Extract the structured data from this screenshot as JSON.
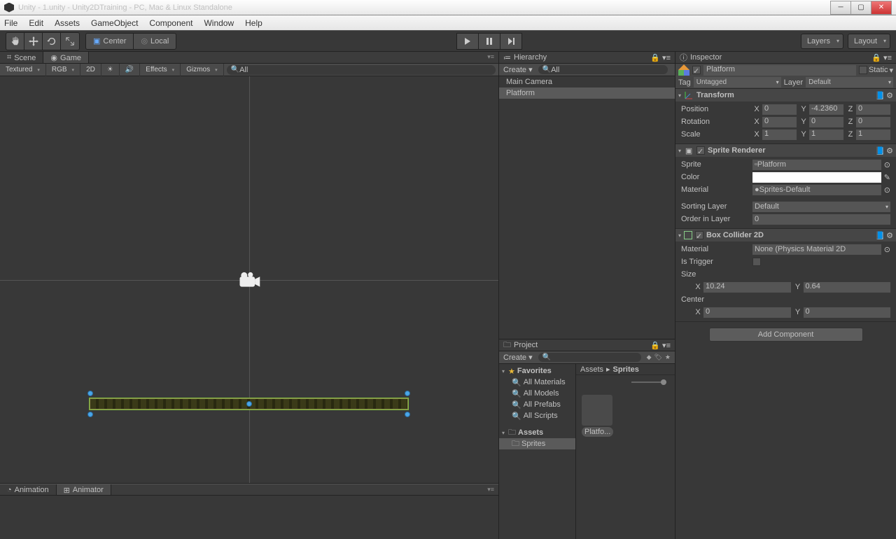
{
  "window": {
    "title": "Unity - 1.unity - Unity2DTraining - PC, Mac & Linux Standalone"
  },
  "menu": [
    "File",
    "Edit",
    "Assets",
    "GameObject",
    "Component",
    "Window",
    "Help"
  ],
  "toolbar": {
    "pivot": "Center",
    "space": "Local",
    "layers": "Layers",
    "layout": "Layout"
  },
  "scene": {
    "tabs": {
      "scene": "Scene",
      "game": "Game"
    },
    "shading": "Textured",
    "rendermode": "RGB",
    "mode": "2D",
    "effects": "Effects",
    "gizmos": "Gizmos",
    "search": "All"
  },
  "hierarchy": {
    "title": "Hierarchy",
    "create": "Create",
    "search": "All",
    "items": [
      "Main Camera",
      "Platform"
    ]
  },
  "project": {
    "title": "Project",
    "create": "Create",
    "favorites": "Favorites",
    "favitems": [
      "All Materials",
      "All Models",
      "All Prefabs",
      "All Scripts"
    ],
    "assets": "Assets",
    "sprites": "Sprites",
    "crumb1": "Assets",
    "crumb2": "Sprites",
    "asset_name": "Platfo..."
  },
  "bottom": {
    "animation": "Animation",
    "animator": "Animator"
  },
  "inspector": {
    "title": "Inspector",
    "objname": "Platform",
    "static": "Static",
    "tag_lbl": "Tag",
    "tag_val": "Untagged",
    "layer_lbl": "Layer",
    "layer_val": "Default",
    "transform": {
      "name": "Transform",
      "position": "Position",
      "px": "0",
      "py": "-4.2360",
      "pz": "0",
      "rotation": "Rotation",
      "rx": "0",
      "ry": "0",
      "rz": "0",
      "scale": "Scale",
      "sx": "1",
      "sy": "1",
      "sz": "1"
    },
    "sprite": {
      "name": "Sprite Renderer",
      "sprite_lbl": "Sprite",
      "sprite_val": "Platform",
      "color_lbl": "Color",
      "material_lbl": "Material",
      "material_val": "Sprites-Default",
      "sortlayer_lbl": "Sorting Layer",
      "sortlayer_val": "Default",
      "order_lbl": "Order in Layer",
      "order_val": "0"
    },
    "boxcol": {
      "name": "Box Collider 2D",
      "material_lbl": "Material",
      "material_val": "None (Physics Material 2D",
      "trigger_lbl": "Is Trigger",
      "size_lbl": "Size",
      "sx": "10.24",
      "sy": "0.64",
      "center_lbl": "Center",
      "cx": "0",
      "cy": "0"
    },
    "add": "Add Component"
  }
}
